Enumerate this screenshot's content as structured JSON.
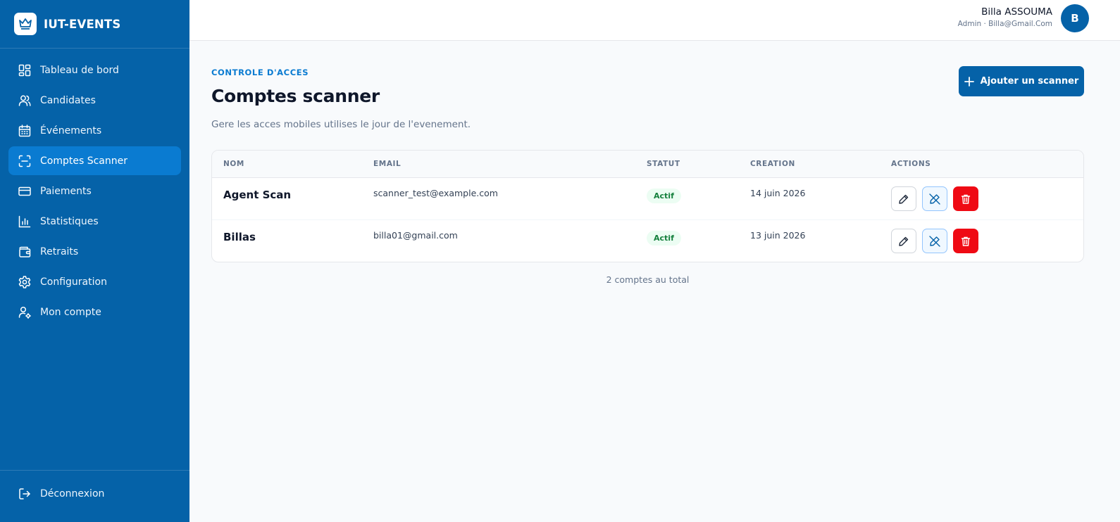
{
  "brand": {
    "name": "IUT-EVENTS"
  },
  "sidebar": {
    "items": [
      {
        "label": "Tableau de bord",
        "icon": "dashboard-icon",
        "active": false
      },
      {
        "label": "Candidates",
        "icon": "users-icon",
        "active": false
      },
      {
        "label": "Événements",
        "icon": "calendar-icon",
        "active": false
      },
      {
        "label": "Comptes Scanner",
        "icon": "scan-icon",
        "active": true
      },
      {
        "label": "Paiements",
        "icon": "credit-card-icon",
        "active": false
      },
      {
        "label": "Statistiques",
        "icon": "bar-chart-icon",
        "active": false
      },
      {
        "label": "Retraits",
        "icon": "wallet-icon",
        "active": false
      },
      {
        "label": "Configuration",
        "icon": "gear-icon",
        "active": false
      },
      {
        "label": "Mon compte",
        "icon": "user-gear-icon",
        "active": false
      }
    ],
    "logout_label": "Déconnexion"
  },
  "header": {
    "user_name": "Billa ASSOUMA",
    "user_meta": "Admin · Billa@Gmail.Com",
    "avatar_initial": "B"
  },
  "main": {
    "eyebrow": "CONTROLE D'ACCES",
    "title": "Comptes scanner",
    "subtitle": "Gere les acces mobiles utilises le jour de l'evenement.",
    "add_button_label": "Ajouter un scanner",
    "table": {
      "columns": [
        "NOM",
        "EMAIL",
        "STATUT",
        "CREATION",
        "ACTIONS"
      ],
      "rows": [
        {
          "name": "Agent Scan",
          "email": "scanner_test@example.com",
          "status": "Actif",
          "created": "14 juin 2026"
        },
        {
          "name": "Billas",
          "email": "billa01@gmail.com",
          "status": "Actif",
          "created": "13 juin 2026"
        }
      ]
    },
    "total_label": "2 comptes au total"
  },
  "colors": {
    "sidebar_bg": "#0562a8",
    "sidebar_active": "#0a7bd1",
    "accent": "#0a7bd1",
    "success": "#15803d",
    "danger": "#ef0a14"
  }
}
